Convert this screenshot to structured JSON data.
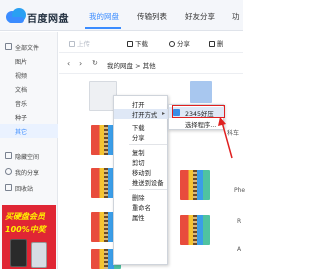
{
  "app": {
    "title": "百度网盘"
  },
  "nav": {
    "tabs": [
      {
        "label": "我的网盘"
      },
      {
        "label": "传输列表"
      },
      {
        "label": "好友分享"
      },
      {
        "label": "功"
      }
    ]
  },
  "sidebar": {
    "items": [
      {
        "label": "全部文件"
      },
      {
        "label": "图片"
      },
      {
        "label": "视频"
      },
      {
        "label": "文档"
      },
      {
        "label": "音乐"
      },
      {
        "label": "种子"
      },
      {
        "label": "其它"
      },
      {
        "label": "隐藏空间"
      },
      {
        "label": "我的分享"
      },
      {
        "label": "回收站"
      }
    ]
  },
  "ad": {
    "line1": "买硬盘会员",
    "line2": "100%中奖"
  },
  "toolbar": {
    "upload": "上传",
    "download": "下载",
    "share": "分享",
    "delete": "删"
  },
  "breadcrumb": {
    "path": "我的网盘 > 其他"
  },
  "files": {
    "label_fragment": "科车",
    "label_phe": "Phe",
    "label_r": "R",
    "label_a": "A"
  },
  "context_menu": {
    "items": [
      {
        "label": "打开"
      },
      {
        "label": "打开方式"
      },
      {
        "label": "下载"
      },
      {
        "label": "分享"
      },
      {
        "label": "复制"
      },
      {
        "label": "剪切"
      },
      {
        "label": "移动到"
      },
      {
        "label": "推送到设备"
      },
      {
        "label": "删除"
      },
      {
        "label": "重命名"
      },
      {
        "label": "属性"
      }
    ]
  },
  "submenu": {
    "items": [
      {
        "label": "2345好压"
      },
      {
        "label": "选择程序..."
      }
    ]
  },
  "colors": {
    "accent": "#3b8cff",
    "annotation": "#e02020"
  }
}
